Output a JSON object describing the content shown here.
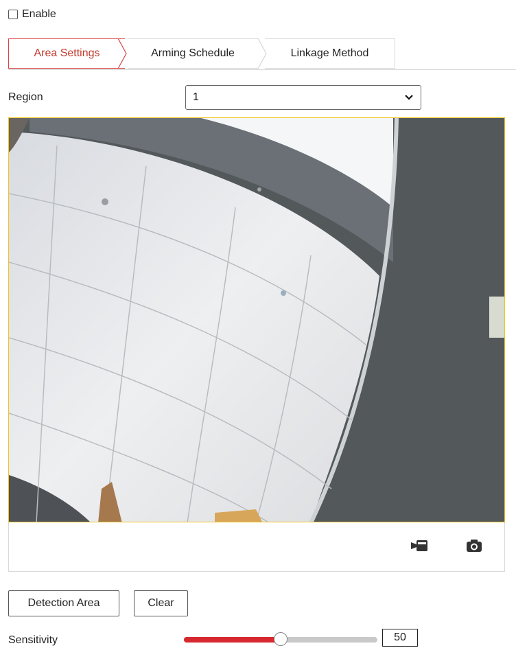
{
  "enable": {
    "label": "Enable",
    "checked": false
  },
  "tabs": [
    {
      "label": "Area Settings",
      "active": true
    },
    {
      "label": "Arming Schedule",
      "active": false
    },
    {
      "label": "Linkage Method",
      "active": false
    }
  ],
  "region": {
    "label": "Region",
    "value": "1"
  },
  "toolbar": {
    "record_icon": "video-record-icon",
    "capture_icon": "camera-capture-icon"
  },
  "buttons": {
    "detection_area": "Detection Area",
    "clear": "Clear"
  },
  "sensitivity": {
    "label": "Sensitivity",
    "value": "50",
    "level_percent": 50
  },
  "colors": {
    "accent": "#d7282f",
    "active_tab": "#c0392b",
    "video_border": "#f0c419"
  }
}
